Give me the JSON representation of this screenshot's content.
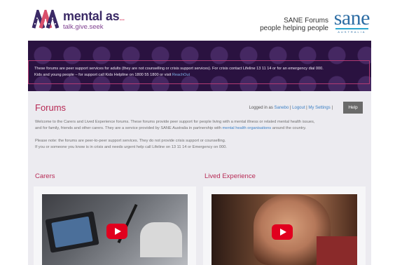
{
  "header": {
    "logo_title": "mental as",
    "logo_dots": "...",
    "logo_tagline": "talk.give.seek",
    "forums_line1": "SANE Forums",
    "forums_line2": "people helping people",
    "sane_word": "sane",
    "sane_country": "AUSTRALIA"
  },
  "notice": {
    "text1": "These forums are peer support services for adults (they are not counselling or crisis support services). For crisis contact Lifeline 13 11 14 or for an emergency dial 000.",
    "text2": "Kids and young people – for support call Kids Helpline on 1800 55 1800 or visit ",
    "link": "ReachOut"
  },
  "main": {
    "title": "Forums",
    "logged_in_prefix": "Logged in as ",
    "username": "Sanebo",
    "logout": "Logout",
    "settings": "My Settings",
    "help": "Help",
    "intro1": "Welcome to the Carers and Lived Experience forums. These forums provide peer support for people living with a mental illness or related mental health issues,",
    "intro2_a": "and for family, friends and other carers. They are a service provided by SANE Australia in partnership with ",
    "intro2_link": "mental health organisations",
    "intro2_b": " around the country.",
    "note1": "Please note: the forums are peer-to-peer support services. They do not provide crisis support or counselling.",
    "note2": "If you or someone you know is in crisis and needs urgent help call Lifeline on 13 11 14 or Emergency on 000."
  },
  "sections": [
    {
      "title": "Carers"
    },
    {
      "title": "Lived Experience"
    }
  ],
  "colors": {
    "accent": "#b72a55",
    "background": "#2a1240",
    "link": "#3b7fc4"
  }
}
